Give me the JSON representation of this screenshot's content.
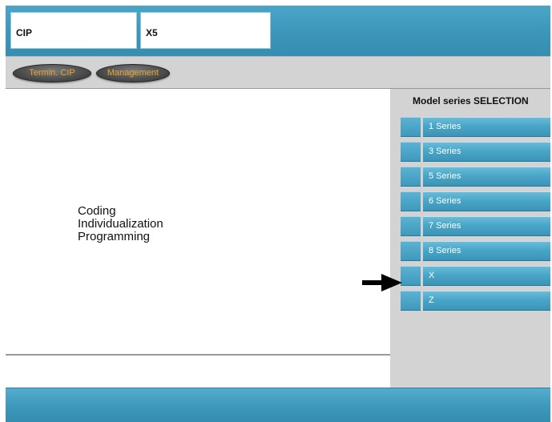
{
  "header": {
    "field_1": "CIP",
    "field_2": "X5"
  },
  "toolbar": {
    "termin_cip_label": "Termin. CIP",
    "management_label": "Management"
  },
  "main": {
    "lines": [
      "Coding",
      "Individualization",
      "Programming"
    ]
  },
  "selection": {
    "title": "Model series SELECTION",
    "items": [
      {
        "label": "1 Series"
      },
      {
        "label": "3 Series"
      },
      {
        "label": "5 Series"
      },
      {
        "label": "6 Series"
      },
      {
        "label": "7 Series"
      },
      {
        "label": "8 Series"
      },
      {
        "label": "X"
      },
      {
        "label": "Z"
      }
    ]
  },
  "icons": {
    "pointer": "arrow-right-icon"
  },
  "colors": {
    "accent_blue": "#4aa6c8",
    "panel_gray": "#d3d3d3",
    "button_text": "#e9a535"
  }
}
